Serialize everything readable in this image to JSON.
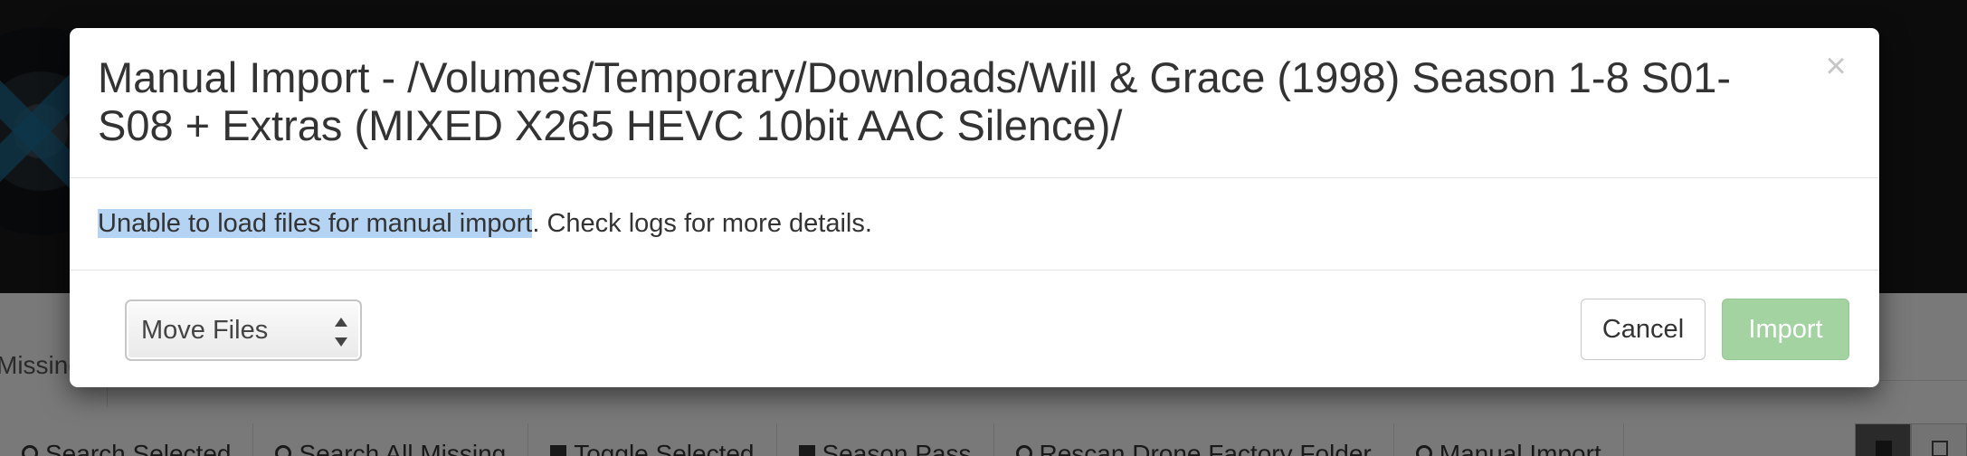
{
  "background": {
    "missing_label": "Missing",
    "toolbar": [
      {
        "label": "Search Selected",
        "icon": "search-icon"
      },
      {
        "label": "Search All Missing",
        "icon": "search-icon"
      },
      {
        "label": "Toggle Selected",
        "icon": "bookmark-icon"
      },
      {
        "label": "Season Pass",
        "icon": "bookmark-icon"
      },
      {
        "label": "Rescan Drone Factory Folder",
        "icon": "refresh-icon"
      },
      {
        "label": "Manual Import",
        "icon": "user-icon"
      }
    ]
  },
  "modal": {
    "title": "Manual Import - /Volumes/Temporary/Downloads/Will & Grace (1998) Season 1-8 S01-S08 + Extras (MIXED X265 HEVC 10bit AAC Silence)/",
    "close_glyph": "×",
    "message_highlighted": "Unable to load files for manual import",
    "message_rest": ". Check logs for more details.",
    "import_mode": "Move Files",
    "cancel_label": "Cancel",
    "import_label": "Import",
    "colors": {
      "import_button": "#a3d3a1",
      "selection_highlight": "#b5d3f2"
    }
  }
}
